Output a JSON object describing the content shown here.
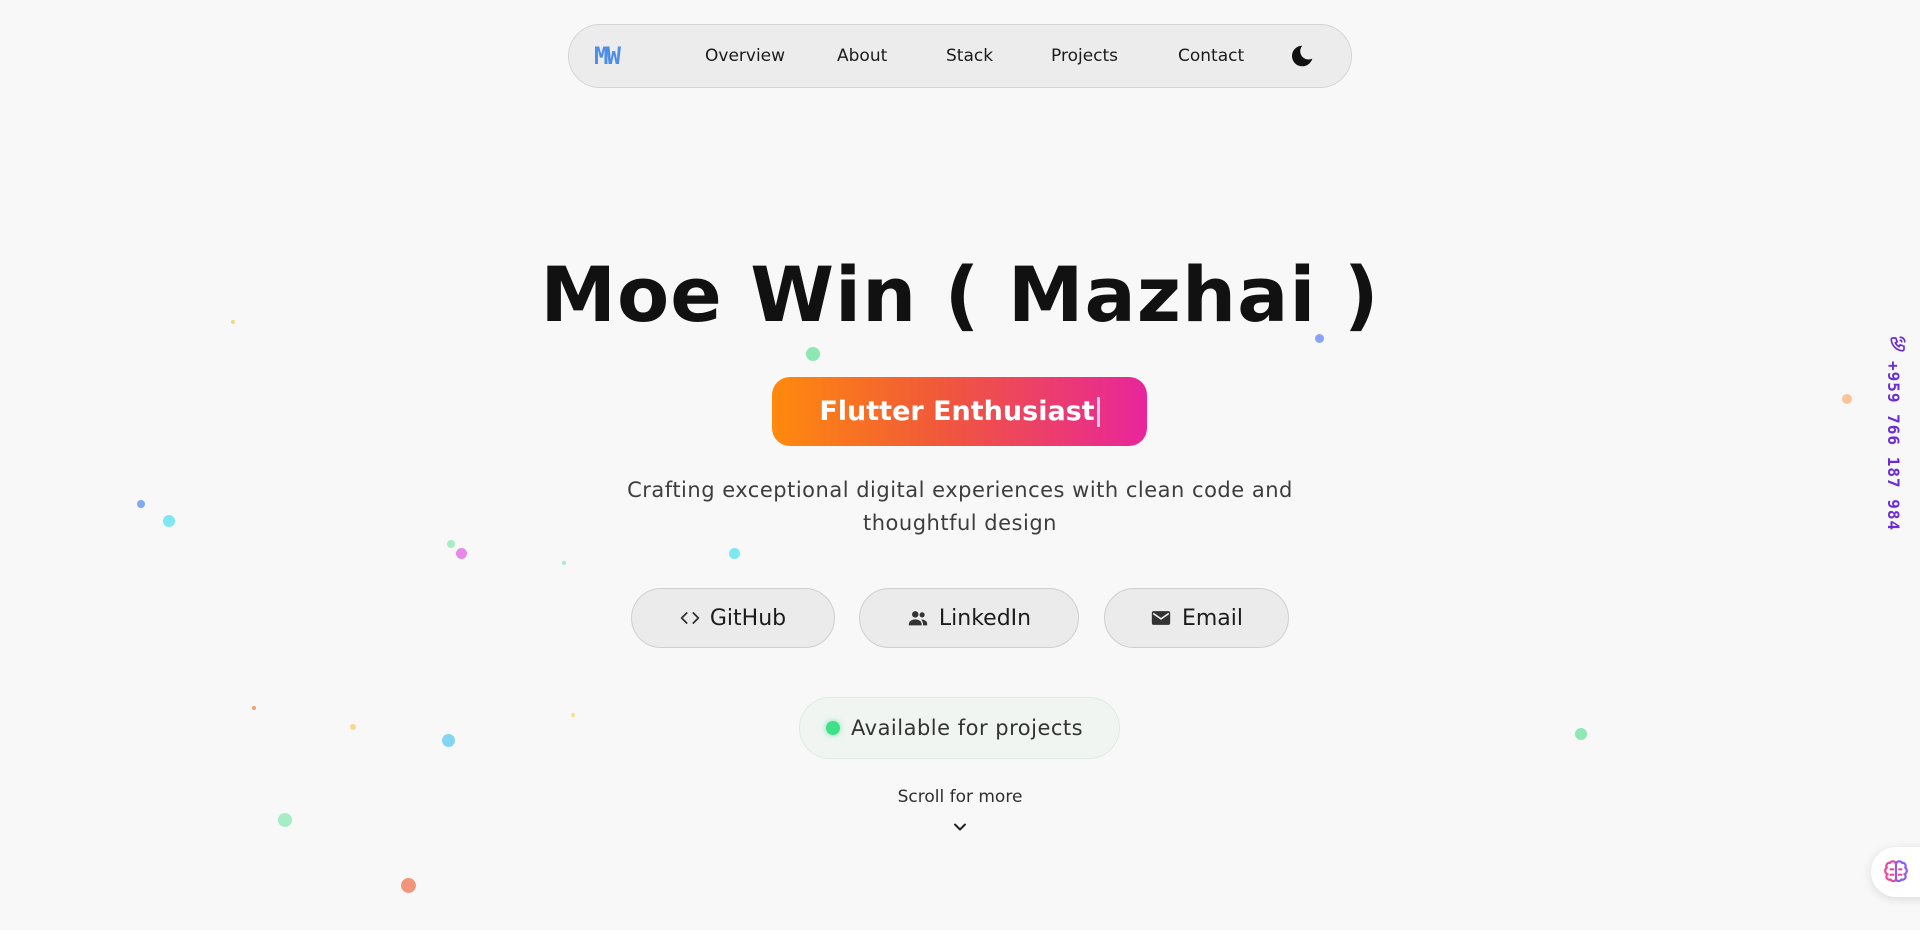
{
  "nav": {
    "logo": "MW",
    "links": [
      "Overview",
      "About",
      "Stack",
      "Projects",
      "Contact"
    ],
    "theme_icon": "moon-icon"
  },
  "hero": {
    "name": "Moe Win ( Mazhai )",
    "role": "Flutter Enthusiast",
    "tagline_line1": "Crafting exceptional digital experiences with clean code and",
    "tagline_line2": "thoughtful design"
  },
  "social": {
    "github": {
      "label": "GitHub",
      "icon": "code-icon"
    },
    "linkedin": {
      "label": "LinkedIn",
      "icon": "people-icon"
    },
    "email": {
      "label": "Email",
      "icon": "mail-icon"
    }
  },
  "status": {
    "label": "Available for projects",
    "color": "#3ee08a"
  },
  "scroll": {
    "label": "Scroll for more",
    "icon": "chevron-down-icon"
  },
  "side": {
    "phone": "+959 766 187 984",
    "icon": "phone-icon",
    "color": "#6b2bd9"
  },
  "fab": {
    "icon": "brain-icon"
  },
  "colors": {
    "logo": "#4f8ee8",
    "gradient_start": "#ff8a0d",
    "gradient_end": "#e8259c",
    "background": "#f8f8f8"
  }
}
